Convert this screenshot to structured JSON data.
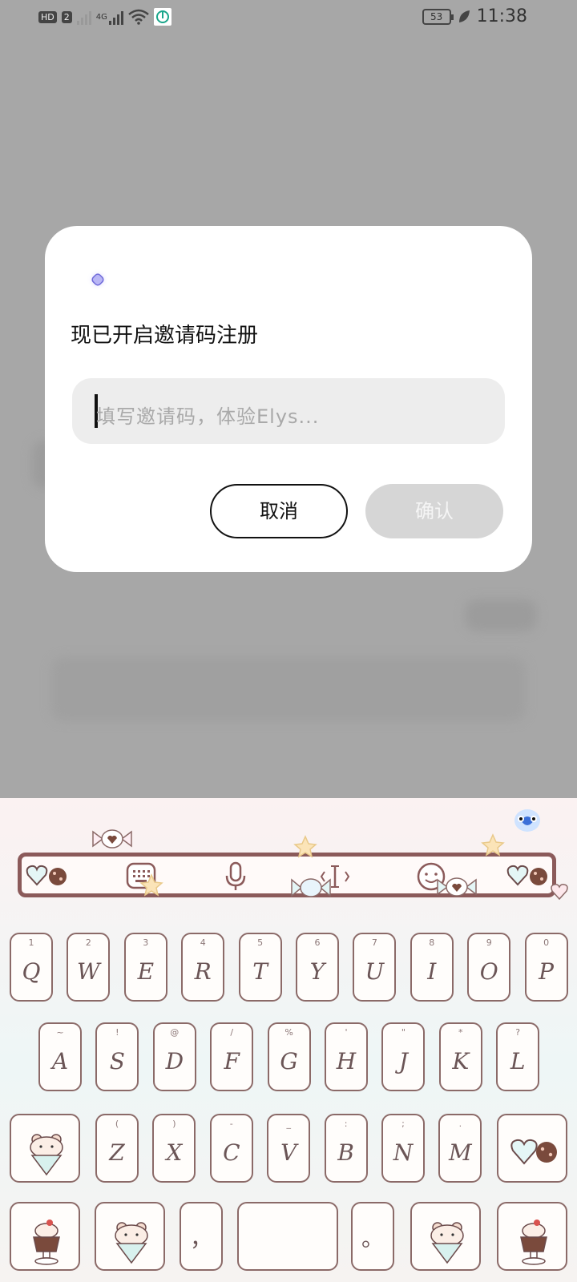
{
  "status_bar": {
    "hd_label": "HD",
    "sim_number": "2",
    "network_type": "4G",
    "battery_level": "53",
    "time": "11:38"
  },
  "dialog": {
    "title": "现已开启邀请码注册",
    "input_placeholder": "填写邀请码，体验Elys...",
    "cancel_label": "取消",
    "confirm_label": "确认"
  },
  "keyboard": {
    "toolbar_icons": [
      "keyboard-icon",
      "microphone-icon",
      "cursor-icon",
      "emoji-icon"
    ],
    "row1": [
      {
        "key": "Q",
        "sub": "1"
      },
      {
        "key": "W",
        "sub": "2"
      },
      {
        "key": "E",
        "sub": "3"
      },
      {
        "key": "R",
        "sub": "4"
      },
      {
        "key": "T",
        "sub": "5"
      },
      {
        "key": "Y",
        "sub": "6"
      },
      {
        "key": "U",
        "sub": "7"
      },
      {
        "key": "I",
        "sub": "8"
      },
      {
        "key": "O",
        "sub": "9"
      },
      {
        "key": "P",
        "sub": "0"
      }
    ],
    "row2": [
      {
        "key": "A",
        "sub": "~"
      },
      {
        "key": "S",
        "sub": "!"
      },
      {
        "key": "D",
        "sub": "@"
      },
      {
        "key": "F",
        "sub": "/"
      },
      {
        "key": "G",
        "sub": "%"
      },
      {
        "key": "H",
        "sub": "'"
      },
      {
        "key": "J",
        "sub": "\""
      },
      {
        "key": "K",
        "sub": "*"
      },
      {
        "key": "L",
        "sub": "?"
      }
    ],
    "row3": [
      {
        "key": "Z",
        "sub": "("
      },
      {
        "key": "X",
        "sub": ")"
      },
      {
        "key": "C",
        "sub": "-"
      },
      {
        "key": "V",
        "sub": "_"
      },
      {
        "key": "B",
        "sub": ":"
      },
      {
        "key": "N",
        "sub": ";"
      },
      {
        "key": "M",
        "sub": "."
      }
    ],
    "comma_key": "，",
    "period_key": "。"
  },
  "colors": {
    "dialog_bg": "#ffffff",
    "input_bg": "#ededed",
    "confirm_disabled": "#d6d6d6",
    "key_border": "#8b6a68",
    "frame_brown": "#8b5a5a"
  }
}
